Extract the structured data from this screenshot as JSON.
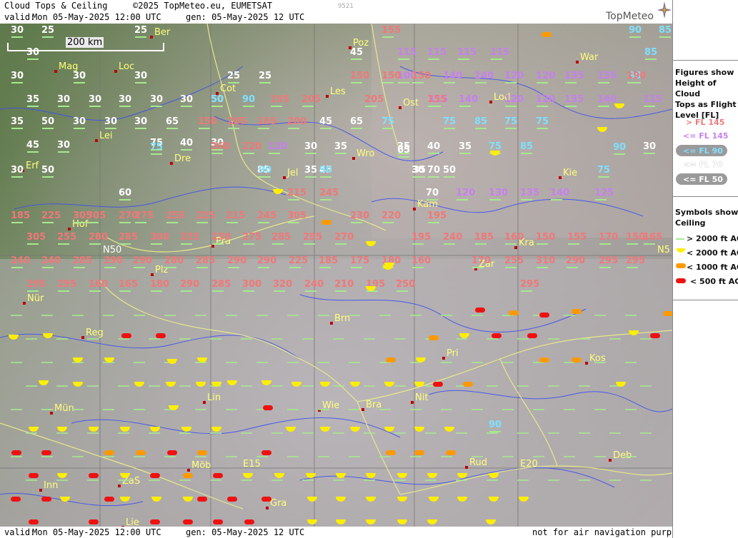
{
  "header": {
    "title": "Cloud Tops & Ceiling",
    "copyright": "©2025 TopMeteo.eu, EUMETSAT",
    "id": "9521",
    "valid_label": "valid:",
    "valid_value": "Mon  05-May-2025  12:00 UTC",
    "gen": "gen: 05-May-2025 12 UTC",
    "logo": "TopMeteo"
  },
  "footer": {
    "valid_label": "valid:",
    "valid_value": "Mon  05-May-2025  12:00 UTC",
    "gen": "gen: 05-May-2025 12 UTC",
    "disclaimer": "not for air navigation purposes"
  },
  "scale_bar": "200 km",
  "legend": {
    "title_lines": [
      "Figures show",
      "Height of Cloud",
      "Tops as Flight",
      "Level  [FL]"
    ],
    "levels": [
      {
        "text": "> FL 145",
        "color": "#f07878"
      },
      {
        "text": "<= FL 145",
        "color": "#c77ff0"
      },
      {
        "text": "<= FL 90",
        "color": "#7fe0ff"
      },
      {
        "text": "<= FL 70",
        "color": "#ffffff"
      },
      {
        "text": "<= FL 50",
        "color": "#ffffff"
      }
    ],
    "symbols_title": [
      "Symbols show",
      "Ceiling"
    ],
    "symbols": [
      {
        "text": "> 2000 ft AGL",
        "color": "#b8f0a0"
      },
      {
        "text": "< 2000 ft AGL",
        "color": "#ffee00"
      },
      {
        "text": "< 1000 ft AGL",
        "color": "#ff9900"
      },
      {
        "text": "< 500 ft AGL",
        "color": "#ee1111"
      }
    ]
  },
  "grid_labels": {
    "n50_left": "N50",
    "n50_right": "N5",
    "e15": "E15",
    "e20": "E20"
  },
  "cities": [
    "Ber",
    "Poz",
    "War",
    "Mag",
    "Loc",
    "Cot",
    "Les",
    "Lod",
    "Ost",
    "Lei",
    "Dre",
    "Wro",
    "Erf",
    "Jel",
    "Kie",
    "Kam",
    "Hof",
    "Pra",
    "Kra",
    "N50",
    "Plz",
    "Zar",
    "Nür",
    "Brn",
    "Reg",
    "Pri",
    "Kos",
    "Lin",
    "Nit",
    "Mün",
    "Wie",
    "Bra",
    "Deb",
    "Rud",
    "Inn",
    "ZaS",
    "Gra",
    "Lie",
    "Möb"
  ],
  "labels_white": [
    "30",
    "25",
    "25",
    "30",
    "30",
    "30",
    "25",
    "25",
    "45",
    "30",
    "35",
    "30",
    "30",
    "30",
    "30",
    "30",
    "50",
    "35",
    "50",
    "30",
    "30",
    "65",
    "45",
    "65",
    "30",
    "45",
    "30",
    "75",
    "40",
    "30",
    "30",
    "35",
    "35",
    "40",
    "35",
    "65",
    "35",
    "70",
    "85",
    "50",
    "35",
    "70",
    "45",
    "60",
    "30",
    "30",
    "50",
    "30"
  ],
  "labels_cyan": [
    "90",
    "85",
    "85",
    "90",
    "50",
    "90",
    "75",
    "75",
    "85",
    "75",
    "75",
    "75",
    "90",
    "75",
    "85",
    "90",
    "90",
    "75",
    "90"
  ],
  "labels_purple": [
    "115",
    "115",
    "115",
    "115",
    "100",
    "140",
    "140",
    "120",
    "120",
    "135",
    "135",
    "115",
    "140",
    "120",
    "120",
    "135",
    "140",
    "115",
    "120",
    "130",
    "135",
    "140",
    "125",
    "120"
  ],
  "labels_pink": [
    "155",
    "150",
    "150",
    "150",
    "190",
    "195",
    "205",
    "205",
    "155",
    "150",
    "285",
    "165",
    "200",
    "260",
    "220",
    "215",
    "245",
    "305",
    "270",
    "275",
    "255",
    "225",
    "215",
    "245",
    "305",
    "230",
    "220",
    "185",
    "225",
    "305",
    "195",
    "305",
    "255",
    "280",
    "285",
    "300",
    "255",
    "250",
    "275",
    "285",
    "295",
    "270",
    "195",
    "240",
    "185",
    "160",
    "150",
    "155",
    "170",
    "150",
    "165",
    "240",
    "240",
    "285",
    "290",
    "290",
    "280",
    "285",
    "290",
    "290",
    "225",
    "185",
    "175",
    "180",
    "160",
    "170",
    "255",
    "310",
    "290",
    "295",
    "295",
    "295",
    "295",
    "160",
    "165",
    "180",
    "290",
    "285",
    "300",
    "320",
    "240",
    "210",
    "195",
    "250",
    "295"
  ],
  "symbol_colors": {
    "green": "#a8e890",
    "yellow": "#ffee00",
    "orange": "#ff9900",
    "red": "#ee1111"
  }
}
